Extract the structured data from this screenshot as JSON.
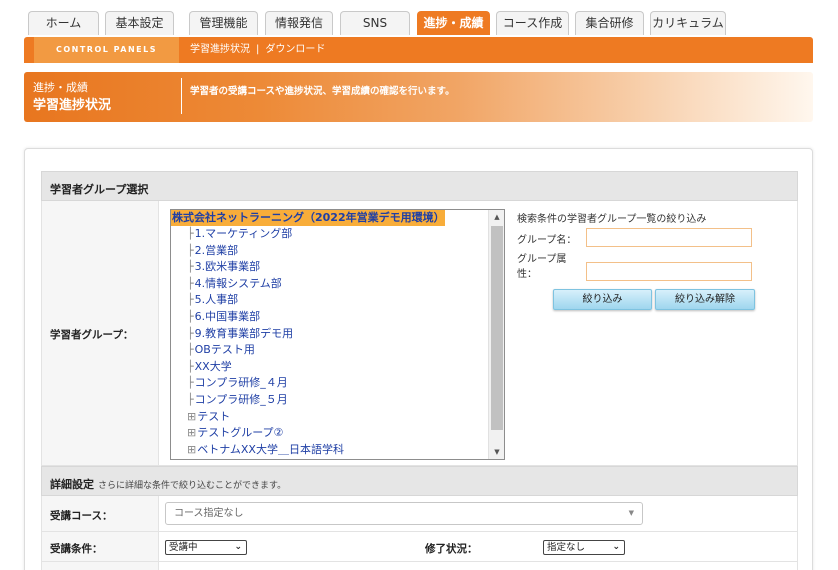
{
  "tabs": [
    "ホーム",
    "基本設定",
    "管理機能",
    "情報発信",
    "SNS",
    "進捗・成績",
    "コース作成",
    "集合研修",
    "カリキュラム"
  ],
  "active_tab": "進捗・成績",
  "control_panels": "CONTROL PANELS",
  "breadcrumbs": [
    "学習進捗状況",
    "ダウンロード"
  ],
  "breadcrumb_sep": "|",
  "banner": {
    "category": "進捗・成績",
    "title": "学習進捗状況",
    "description": "学習者の受講コースや進捗状況、学習成績の確認を行います。"
  },
  "group_section": {
    "title": "学習者グループ選択",
    "row_label": "学習者グループ："
  },
  "tree": {
    "root": "株式会社ネットラーニング（2022年営業デモ用環境）",
    "items": [
      {
        "prefix": "├",
        "label": "1.マーケティング部"
      },
      {
        "prefix": "├",
        "label": "2.営業部"
      },
      {
        "prefix": "├",
        "label": "3.欧米事業部"
      },
      {
        "prefix": "├",
        "label": "4.情報システム部"
      },
      {
        "prefix": "├",
        "label": "5.人事部"
      },
      {
        "prefix": "├",
        "label": "6.中国事業部"
      },
      {
        "prefix": "├",
        "label": "9.教育事業部デモ用"
      },
      {
        "prefix": "├",
        "label": "OBテスト用"
      },
      {
        "prefix": "├",
        "label": "XX大学"
      },
      {
        "prefix": "├",
        "label": "コンプラ研修_４月"
      },
      {
        "prefix": "├",
        "label": "コンプラ研修_５月"
      },
      {
        "prefix": "⊞",
        "label": "テスト"
      },
      {
        "prefix": "⊞",
        "label": "テストグループ②"
      },
      {
        "prefix": "⊞",
        "label": "ベトナムXX大学＿日本語学科"
      }
    ]
  },
  "filter": {
    "title": "検索条件の学習者グループ一覧の絞り込み",
    "name_label": "グループ名：",
    "attr_label_1": "グループ属",
    "attr_label_2": "性：",
    "name_value": "",
    "attr_value": "",
    "apply_button": "絞り込み",
    "clear_button": "絞り込み解除"
  },
  "detail_section": {
    "title": "詳細設定",
    "note": "さらに詳細な条件で絞り込むことができます。",
    "course_label": "受講コース：",
    "course_value": "コース指定なし",
    "condition_label": "受講条件：",
    "condition_value": "受講中",
    "completion_label": "修了状況：",
    "completion_value": "指定なし"
  },
  "colors": {
    "accent": "#ee7a22",
    "tree_highlight": "#f8ad3a",
    "link": "#1f3fa5",
    "button": "#9fd6ee"
  }
}
